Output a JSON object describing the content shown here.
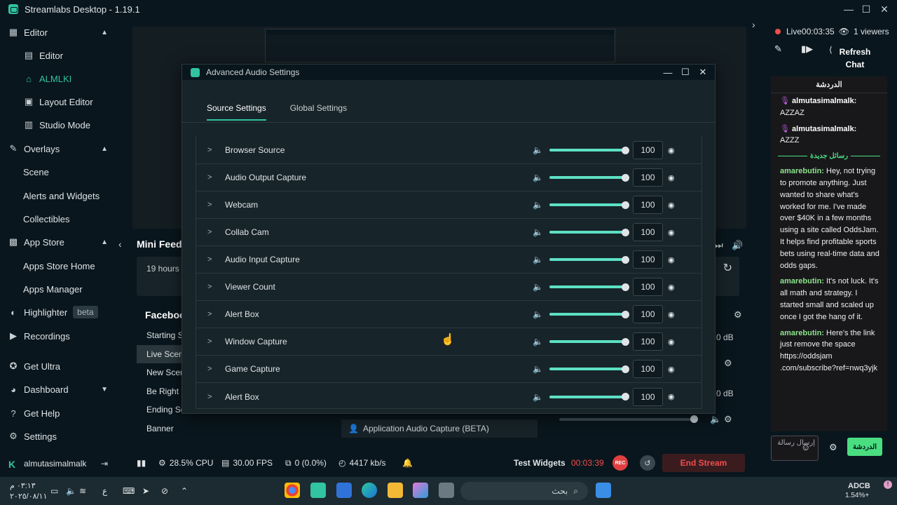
{
  "app": {
    "title": "Streamlabs Desktop - 1.19.1"
  },
  "sidebar": {
    "editor": "Editor",
    "editor_sub": "Editor",
    "almlki": "ALMLKI",
    "layout_editor": "Layout Editor",
    "studio_mode": "Studio Mode",
    "overlays": "Overlays",
    "scene": "Scene",
    "alerts_widgets": "Alerts and Widgets",
    "collectibles": "Collectibles",
    "app_store": "App Store",
    "apps_store_home": "Apps Store Home",
    "apps_manager": "Apps Manager",
    "highlighter": "Highlighter",
    "beta": "beta",
    "recordings": "Recordings",
    "get_ultra": "Get Ultra",
    "dashboard": "Dashboard",
    "get_help": "Get Help",
    "settings": "Settings",
    "username": "almutasimalmalk"
  },
  "main": {
    "mini_feed": "Mini Feed",
    "mini_time": "19 hours",
    "scenes_header": "Faceboo",
    "scenes": [
      "Starting S",
      "Live Scen",
      "New Scer",
      "Be Right E",
      "Ending Sc",
      "Banner"
    ],
    "app_audio": "Application Audio Capture (BETA)",
    "db1": "0 dB",
    "db2": "0 dB"
  },
  "status": {
    "cpu": "28.5% CPU",
    "fps": "30.00 FPS",
    "dropped": "0 (0.0%)",
    "bitrate": "4417 kb/s",
    "test_widgets": "Test Widgets",
    "timer": "00:03:39",
    "rec": "REC",
    "end_stream": "End Stream"
  },
  "chat": {
    "live_label": "Live",
    "live_time": "00:03:35",
    "viewers": "1 viewers",
    "refresh": "Refresh Chat",
    "header": "الدردشة",
    "new_messages": "رسائل جديدة",
    "messages": [
      {
        "user": "almutasimalmalk:",
        "text": "AZZAZ"
      },
      {
        "user": "almutasimalmalk:",
        "text": "AZZZ"
      },
      {
        "user": "amarebutin:",
        "text": "Hey, not trying to promote anything. Just wanted to share what's worked for me. I've made over $40K in a few months using a site called OddsJam. It helps find profitable sports bets using real-time data and odds gaps."
      },
      {
        "user": "amarebutin:",
        "text": "It's not luck. It's all math and strategy. I started small and scaled up once I got the hang of it."
      },
      {
        "user": "amarebutin:",
        "text": "Here's the link just remove the space https://oddsjam .com/subscribe?ref=nwq3yjk"
      }
    ],
    "input_placeholder": "إرسال رسالة",
    "send": "الدردشة"
  },
  "modal": {
    "title": "Advanced Audio Settings",
    "tab_source": "Source Settings",
    "tab_global": "Global Settings",
    "sources": [
      {
        "name": "Browser Source",
        "volume": "100"
      },
      {
        "name": "Audio Output Capture",
        "volume": "100"
      },
      {
        "name": "Webcam",
        "volume": "100"
      },
      {
        "name": "Collab Cam",
        "volume": "100"
      },
      {
        "name": "Audio Input Capture",
        "volume": "100"
      },
      {
        "name": "Viewer Count",
        "volume": "100"
      },
      {
        "name": "Alert Box",
        "volume": "100"
      },
      {
        "name": "Window Capture",
        "volume": "100"
      },
      {
        "name": "Game Capture",
        "volume": "100"
      },
      {
        "name": "Alert Box",
        "volume": "100"
      }
    ]
  },
  "taskbar": {
    "time": "٠٣:١٣ م",
    "date": "٢٠٢٥/٠٨/١١",
    "lang": "ع",
    "search": "بحث",
    "ticker": "ADCB",
    "ticker_change": "1.54%+"
  }
}
